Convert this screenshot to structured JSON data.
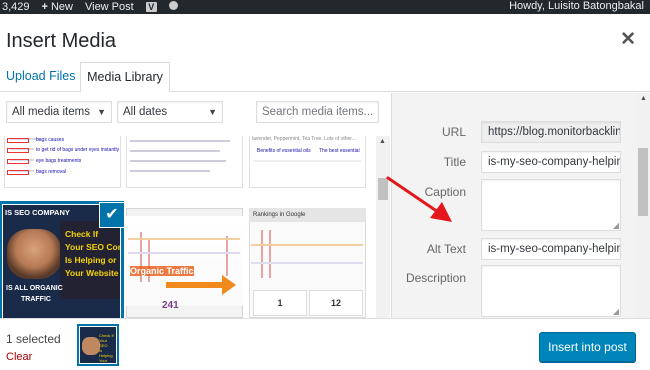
{
  "admin_bar": {
    "comments_count": "3,429",
    "new_label": "New",
    "view_post_label": "View Post",
    "howdy": "Howdy, Luisito Batongbakal"
  },
  "modal": {
    "title": "Insert Media",
    "tabs": [
      {
        "label": "Upload Files",
        "active": false
      },
      {
        "label": "Media Library",
        "active": true
      }
    ]
  },
  "filters": {
    "media_type": "All media items",
    "dates": "All dates",
    "search_placeholder": "Search media items..."
  },
  "thumbnails": {
    "t1": {
      "lines": [
        "bags causes",
        "to get rid of bags under eyes instantly",
        "eye bags treatments",
        "bags removal"
      ]
    },
    "t3": {
      "lines": [
        "lavender, Peppermint, Tea Tree. Lots of other...",
        "Benefits of essential oils",
        "The best essential"
      ]
    },
    "t4": {
      "title": "IS SEO COMPANY",
      "lines": [
        "Check If",
        "Your SEO Com",
        "Is Helping or",
        "Your Website"
      ],
      "bottom": [
        "IS ALL ORGANIC",
        "TRAFFIC"
      ]
    },
    "t5": {
      "label": "Organic Traffic",
      "number": "241"
    },
    "t6": {
      "header": "Rankings in Google",
      "stat1": "1",
      "stat2": "12"
    }
  },
  "details": {
    "url_label": "URL",
    "url_value": "https://blog.monitorbacklin",
    "title_label": "Title",
    "title_value": "is-my-seo-company-helpin",
    "caption_label": "Caption",
    "alt_label": "Alt Text",
    "alt_value": "is-my-seo-company-helpin",
    "description_label": "Description"
  },
  "footer": {
    "selected_text": "1 selected",
    "clear_label": "Clear",
    "insert_label": "Insert into post"
  },
  "colors": {
    "accent": "#0073aa",
    "primary_button": "#0085ba",
    "annotation_arrow": "#e3171c"
  },
  "icons": {
    "close": "close-icon",
    "check": "checkmark-icon",
    "plus": "plus-icon"
  }
}
